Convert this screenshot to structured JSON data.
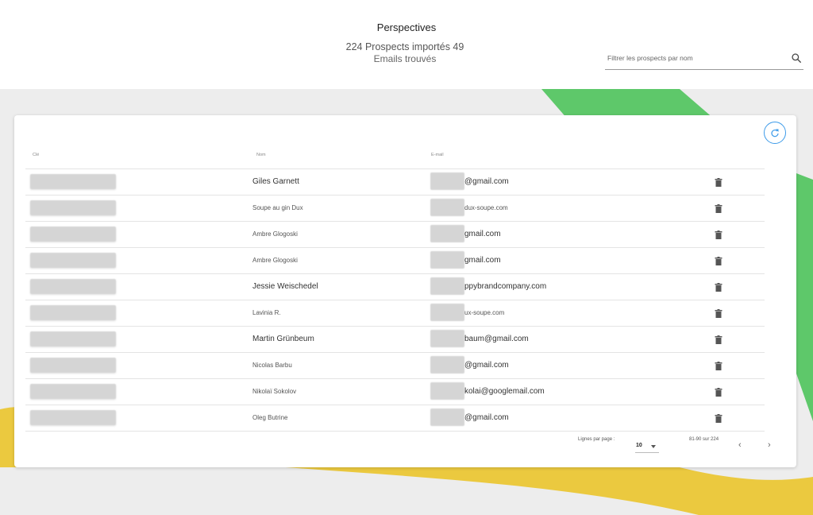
{
  "header": {
    "title": "Perspectives",
    "stats_line1": "224 Prospects importés 49",
    "stats_line2": "Emails trouvés",
    "search_placeholder": "Filtrer les prospects par nom"
  },
  "table": {
    "columns": [
      "Clé",
      "Nom",
      "E-mail"
    ],
    "rows": [
      {
        "name": "Giles Garnett",
        "email": "@gmail.com"
      },
      {
        "name": "Soupe au gin Dux",
        "email": "dux-soupe.com"
      },
      {
        "name": "Ambre Glogoski",
        "email": "gmail.com"
      },
      {
        "name": "Ambre Glogoski",
        "email": "gmail.com"
      },
      {
        "name": "Jessie Weischedel",
        "email": "ppybrandcompany.com"
      },
      {
        "name": "Lavinia R.",
        "email": "ux-soupe.com"
      },
      {
        "name": "Martin Grünbeum",
        "email": "baum@gmail.com"
      },
      {
        "name": "Nicolas Barbu",
        "email": "@gmail.com"
      },
      {
        "name": "Nikolaï Sokolov",
        "email": "kolai@googlemail.com"
      },
      {
        "name": "Oleg Butrine",
        "email": "@gmail.com"
      }
    ]
  },
  "pagination": {
    "rows_per_page_label": "Lignes par page :",
    "rows_per_page_value": "10",
    "range": "81-90 sur 224",
    "prev": "‹",
    "next": "›"
  },
  "colors": {
    "accent_blue": "#3d9be9",
    "bg_green": "#5ec86a",
    "bg_yellow": "#ebc93f"
  }
}
